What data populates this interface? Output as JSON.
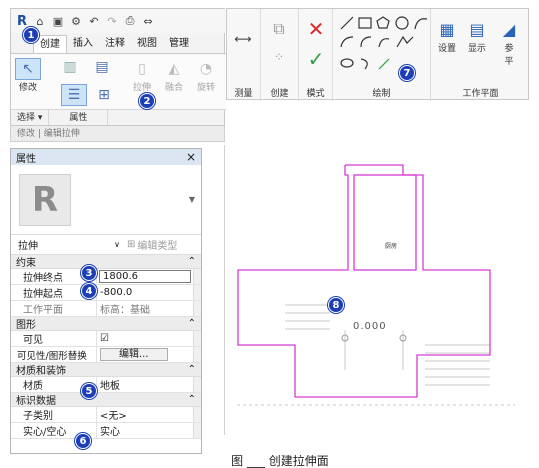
{
  "left_ribbon": {
    "tabs": [
      "创建",
      "插入",
      "注释",
      "视图",
      "管理"
    ],
    "tools": {
      "modify": "修改",
      "extrude": "拉伸",
      "blend": "融合",
      "revolve": "旋转"
    },
    "footer": [
      "选择 ▾",
      "属性"
    ]
  },
  "right_ribbon": {
    "partial_label": "测量",
    "groups": {
      "create": "创建",
      "mode": "模式",
      "draw": "绘制",
      "workplane": "工作平面"
    },
    "tools": {
      "set": "设置",
      "show": "显示",
      "ref_partial": "参",
      "ping_partial": "平"
    }
  },
  "modebar": {
    "text": "修改 | 编辑拉伸"
  },
  "properties": {
    "title": "属性",
    "close": "×",
    "type_name": "拉伸",
    "edit_type": "编辑类型",
    "sections": {
      "constraints": "约束",
      "graphics": "图形",
      "materials": "材质和装饰",
      "identity": "标识数据"
    },
    "rows": {
      "extrude_end": {
        "label": "拉伸终点",
        "value": "1800.6"
      },
      "extrude_start": {
        "label": "拉伸起点",
        "value": "-800.0"
      },
      "work_plane": {
        "label": "工作平面",
        "value": "标高：基础"
      },
      "visible": {
        "label": "可见",
        "value": "☑"
      },
      "visibility_override": {
        "label": "可见性/图形替换",
        "value": "编辑..."
      },
      "material": {
        "label": "材质",
        "value": "地板"
      },
      "subcategory": {
        "label": "子类别",
        "value": "<无>"
      },
      "solid_void": {
        "label": "实心/空心",
        "value": "实心"
      }
    }
  },
  "drawing": {
    "elevation_label": "0.000",
    "room_label": "厨房"
  },
  "badges": [
    "1",
    "2",
    "3",
    "4",
    "5",
    "6",
    "7",
    "8"
  ],
  "caption": "图 ___ 创建拉伸面",
  "colors": {
    "badge": "#1c3fb8",
    "sketch_line": "#d63cd6",
    "delete_red": "#d92b2b",
    "finish_green": "#2ea043"
  }
}
